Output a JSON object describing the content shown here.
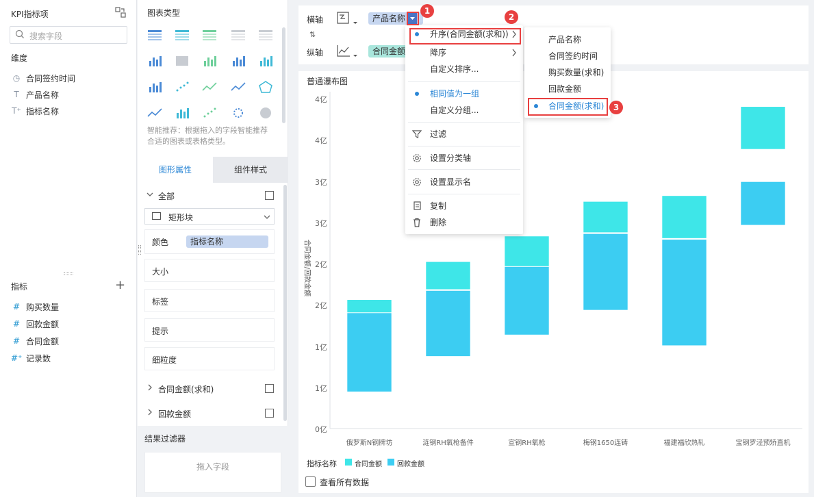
{
  "left": {
    "title": "KPI指标项",
    "search_placeholder": "搜索字段",
    "dimensions_label": "维度",
    "dimensions": [
      {
        "icon": "clock-icon",
        "label": "合同签约时间"
      },
      {
        "icon": "text-t-icon",
        "label": "产品名称"
      },
      {
        "icon": "text-t-plus-icon",
        "label": "指标名称"
      }
    ],
    "measures_label": "指标",
    "measures": [
      {
        "icon": "hash-icon",
        "label": "购买数量"
      },
      {
        "icon": "hash-icon",
        "label": "回款金额"
      },
      {
        "icon": "hash-icon",
        "label": "合同金额"
      },
      {
        "icon": "hash-plus-icon",
        "label": "记录数"
      }
    ]
  },
  "chart_types": {
    "title": "图表类型",
    "hint": "智能推荐：根据拖入的字段智能推荐合适的图表或表格类型。"
  },
  "tabs": {
    "graphic": "图形属性",
    "component": "组件样式"
  },
  "props": {
    "all": "全部",
    "shape": "矩形块",
    "color_label": "颜色",
    "color_field": "指标名称",
    "size": "大小",
    "label": "标签",
    "tooltip": "提示",
    "granularity": "细粒度",
    "contract": "合同金额(求和)",
    "payment": "回款金额"
  },
  "result_filter": {
    "title": "结果过滤器",
    "drop": "拖入字段"
  },
  "axis": {
    "x_label": "横轴",
    "y_label": "纵轴",
    "x_field": "产品名称",
    "y_field": "合同金额",
    "swap": "⇅"
  },
  "menu": {
    "asc": "升序(合同金额(求和))",
    "desc": "降序",
    "custom_sort": "自定义排序...",
    "same_group": "相同值为一组",
    "custom_group": "自定义分组...",
    "filter": "过滤",
    "set_axis": "设置分类轴",
    "set_name": "设置显示名",
    "copy": "复制",
    "delete": "删除"
  },
  "submenu": [
    "产品名称",
    "合同签约时间",
    "购买数量(求和)",
    "回款金额",
    "合同金额(求和)"
  ],
  "badges": [
    "1",
    "2",
    "3"
  ],
  "chart_data": {
    "type": "bar",
    "title": "普通瀑布图",
    "ylabel": "合同金额/回款金额",
    "y_ticks": [
      "0亿",
      "1亿",
      "1亿",
      "2亿",
      "2亿",
      "3亿",
      "3亿",
      "4亿",
      "4亿"
    ],
    "categories": [
      "俄罗斯N钢牌坊",
      "涟钢RH氧枪备件",
      "宣钢RH氧枪",
      "梅钢1650连铸",
      "福建福欣热轧",
      "宝钢罗泾预矫直机"
    ],
    "series": [
      {
        "name": "合同金额",
        "color": "#3ee6e8",
        "ranges": [
          [
            1.4,
            1.56
          ],
          [
            1.68,
            2.02
          ],
          [
            1.96,
            2.33
          ],
          [
            2.37,
            2.75
          ],
          [
            2.3,
            2.82
          ],
          [
            3.38,
            3.9
          ]
        ]
      },
      {
        "name": "回款金额",
        "color": "#3ccdf2",
        "ranges": [
          [
            0.44,
            1.4
          ],
          [
            0.87,
            1.67
          ],
          [
            1.13,
            1.96
          ],
          [
            1.43,
            2.36
          ],
          [
            1.0,
            2.29
          ],
          [
            2.46,
            2.99
          ]
        ]
      }
    ],
    "legend_title": "指标名称",
    "legend_position": "bottom-left",
    "ylim": [
      0,
      4.0
    ],
    "show_all_label": "查看所有数据"
  }
}
